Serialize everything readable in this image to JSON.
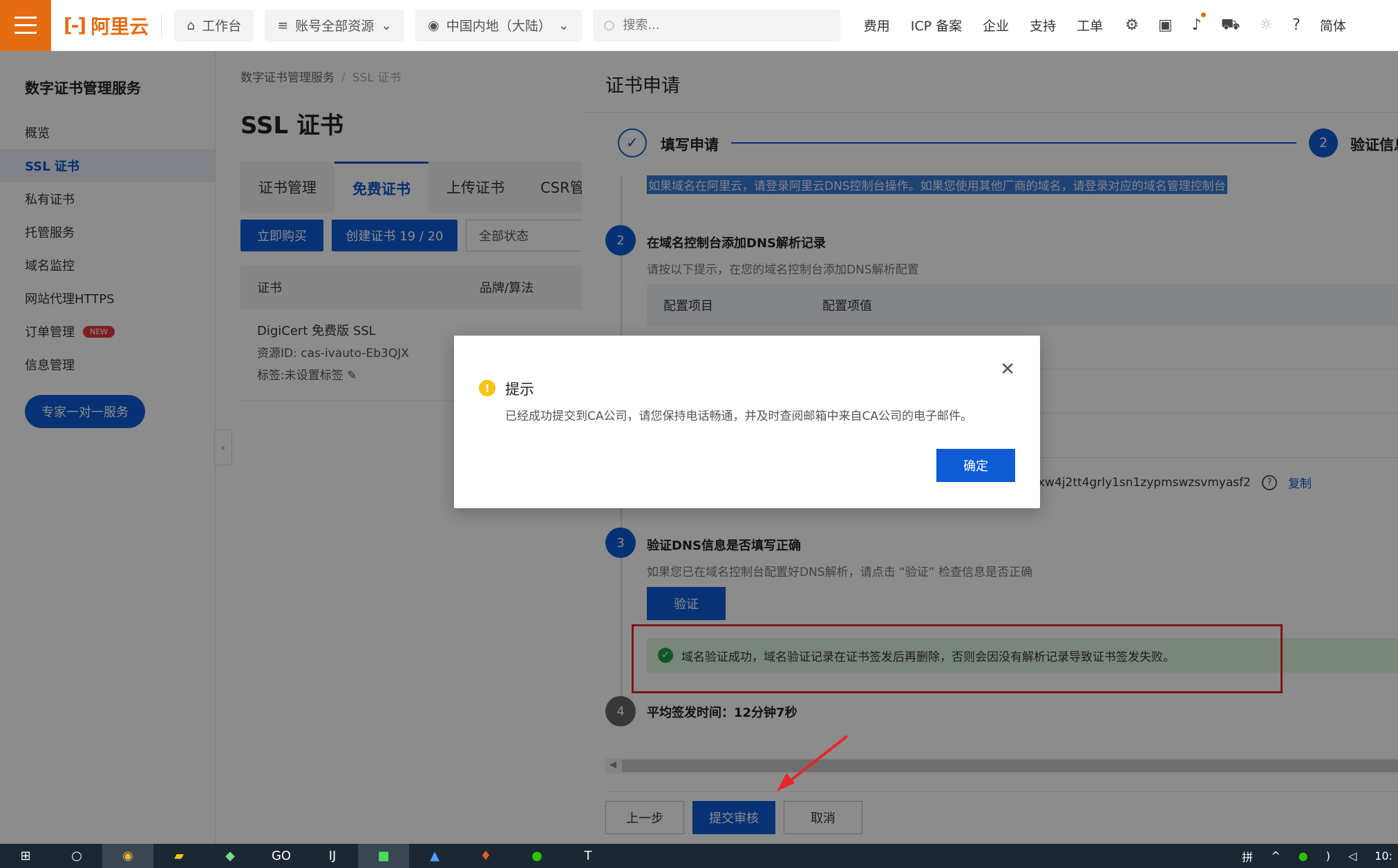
{
  "topnav": {
    "logo_text": "阿里云",
    "workbench": "工作台",
    "account_resources": "账号全部资源",
    "region": "中国内地（大陆）",
    "search_placeholder": "搜索...",
    "links": [
      "费用",
      "ICP 备案",
      "企业",
      "支持",
      "工单"
    ],
    "lang": "简体"
  },
  "sidebar": {
    "title": "数字证书管理服务",
    "items": [
      "概览",
      "SSL 证书",
      "私有证书",
      "托管服务",
      "域名监控",
      "网站代理HTTPS",
      "订单管理",
      "信息管理"
    ],
    "new_badge": "NEW",
    "expert_button": "专家一对一服务"
  },
  "main": {
    "breadcrumb": [
      "数字证书管理服务",
      "SSL 证书"
    ],
    "title": "SSL 证书",
    "tabs": [
      "证书管理",
      "免费证书",
      "上传证书",
      "CSR管理"
    ],
    "buy_button": "立即购买",
    "create_button": "创建证书 19 / 20",
    "status_select": "全部状态",
    "table_headers": [
      "证书",
      "品牌/算法"
    ],
    "row": {
      "name": "DigiCert 免费版 SSL",
      "resource_id": "资源ID: cas-ivauto-Eb3QJX",
      "tag": "标签:未设置标签"
    }
  },
  "drawer": {
    "title": "证书申请",
    "step1": "填写申请",
    "step2_num": "2",
    "step2": "验证信息",
    "highlight_text": "如果域名在阿里云，请登录阿里云DNS控制台操作。如果您使用其他厂商的域名，请登录对应的域名管理控制台",
    "sec2_num": "2",
    "sec2_title": "在域名控制台添加DNS解析记录",
    "sec2_sub": "请按以下提示，在您的域名控制台添加DNS解析配置",
    "cfg_headers": [
      "配置项目",
      "配置项值"
    ],
    "record_value": "xw4j2tt4grly1sn1zypmswzsvmyasf2",
    "copy": "复制",
    "sec3_num": "3",
    "sec3_title": "验证DNS信息是否填写正确",
    "sec3_sub": "如果您已在域名控制台配置好DNS解析，请点击 “验证” 检查信息是否正确",
    "verify_button": "验证",
    "success_msg": "域名验证成功，域名验证记录在证书签发后再删除，否则会因没有解析记录导致证书签发失败。",
    "sec4_num": "4",
    "avg_time": "平均签发时间：12分钟7秒",
    "prev_button": "上一步",
    "submit_button": "提交审核",
    "cancel_button": "取消"
  },
  "dialog": {
    "title": "提示",
    "message": "已经成功提交到CA公司，请您保持电话畅通，并及时查阅邮箱中来自CA公司的电子邮件。",
    "ok_button": "确定"
  },
  "taskbar": {
    "ime": "拼",
    "clock": "10:"
  },
  "colors": {
    "brand_orange": "#e66c12",
    "primary_blue": "#0d5bd5",
    "highlight_red": "#e8262a",
    "success_green": "#1e9e3e"
  }
}
